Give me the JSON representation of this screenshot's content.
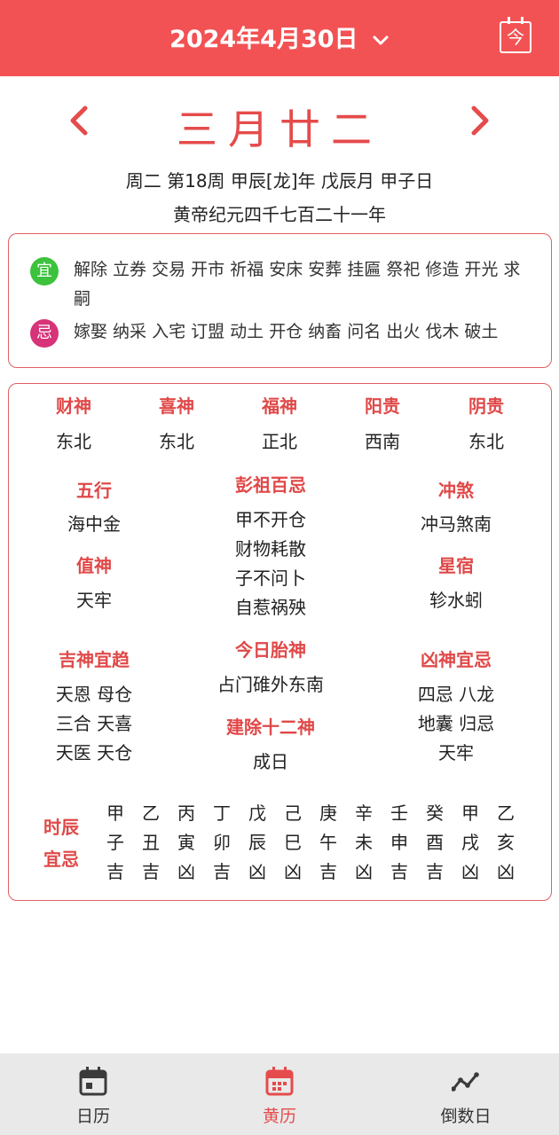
{
  "header": {
    "date": "2024年4月30日",
    "today_button": "今"
  },
  "lunar": {
    "title": "三月廿二",
    "info_line1": "周二 第18周 甲辰[龙]年 戊辰月 甲子日",
    "info_line2": "黄帝纪元四千七百二十一年"
  },
  "yiji": {
    "yi_badge": "宜",
    "yi_text": "解除 立券 交易 开市 祈福 安床 安葬 挂匾 祭祀 修造 开光 求嗣",
    "ji_badge": "忌",
    "ji_text": "嫁娶 纳采 入宅 订盟 动土 开仓 纳畜 问名 出火 伐木 破土"
  },
  "gods": [
    {
      "name": "财神",
      "dir": "东北"
    },
    {
      "name": "喜神",
      "dir": "东北"
    },
    {
      "name": "福神",
      "dir": "正北"
    },
    {
      "name": "阳贵",
      "dir": "西南"
    },
    {
      "name": "阴贵",
      "dir": "东北"
    }
  ],
  "details": {
    "wuxing_h": "五行",
    "wuxing_v": "海中金",
    "zhishen_h": "值神",
    "zhishen_v": "天牢",
    "pengzu_h": "彭祖百忌",
    "pengzu_v": [
      "甲不开仓",
      "财物耗散",
      "子不问卜",
      "自惹祸殃"
    ],
    "chongsha_h": "冲煞",
    "chongsha_v": "冲马煞南",
    "xingxiu_h": "星宿",
    "xingxiu_v": "轸水蚓",
    "jishen_h": "吉神宜趋",
    "jishen_v": [
      "天恩 母仓",
      "三合 天喜",
      "天医 天仓"
    ],
    "taishen_h": "今日胎神",
    "taishen_v": "占门碓外东南",
    "jianchu_h": "建除十二神",
    "jianchu_v": "成日",
    "xiongshen_h": "凶神宜忌",
    "xiongshen_v": [
      "四忌 八龙",
      "地囊 归忌",
      "天牢"
    ]
  },
  "shichen": {
    "label_1": "时辰",
    "label_2": "宜忌",
    "stems": [
      "甲",
      "乙",
      "丙",
      "丁",
      "戊",
      "己",
      "庚",
      "辛",
      "壬",
      "癸",
      "甲",
      "乙"
    ],
    "branches": [
      "子",
      "丑",
      "寅",
      "卯",
      "辰",
      "巳",
      "午",
      "未",
      "申",
      "酉",
      "戌",
      "亥"
    ],
    "luck": [
      "吉",
      "吉",
      "凶",
      "吉",
      "凶",
      "凶",
      "吉",
      "凶",
      "吉",
      "吉",
      "凶",
      "凶"
    ]
  },
  "nav": {
    "items": [
      {
        "label": "日历",
        "icon": "calendar-icon"
      },
      {
        "label": "黄历",
        "icon": "almanac-calendar-icon"
      },
      {
        "label": "倒数日",
        "icon": "trend-line-icon"
      }
    ],
    "active": "黄历",
    "active_color": "#e54b4b",
    "brand_color": "#f25253"
  }
}
